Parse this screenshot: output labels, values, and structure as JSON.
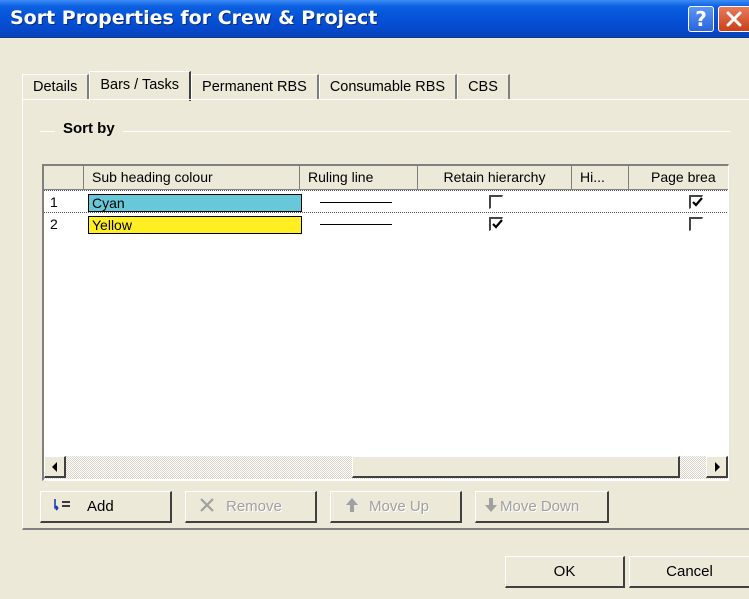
{
  "window": {
    "title": "Sort Properties for Crew & Project",
    "help_label": "?"
  },
  "tabs": [
    {
      "label": "Details"
    },
    {
      "label": "Bars / Tasks"
    },
    {
      "label": "Permanent RBS"
    },
    {
      "label": "Consumable RBS"
    },
    {
      "label": "CBS"
    }
  ],
  "active_tab": "Bars / Tasks",
  "group": {
    "label": "Sort by"
  },
  "grid": {
    "columns": [
      "",
      "Sub heading colour",
      "Ruling line",
      "Retain hierarchy",
      "Hi...",
      "Page brea"
    ],
    "rows": [
      {
        "num": "1",
        "colour": "Cyan",
        "colour_hex": "#66c8d8",
        "ruling_line": "solid",
        "retain_hierarchy": false,
        "page_break": true
      },
      {
        "num": "2",
        "colour": "Yellow",
        "colour_hex": "#ffee22",
        "ruling_line": "solid",
        "retain_hierarchy": true,
        "page_break": false
      }
    ]
  },
  "buttons": {
    "add": "Add",
    "remove": "Remove",
    "move_up": "Move Up",
    "move_down": "Move Down",
    "ok": "OK",
    "cancel": "Cancel"
  },
  "colors": {
    "titlebar": "#0550d6",
    "face": "#ece9d8"
  }
}
